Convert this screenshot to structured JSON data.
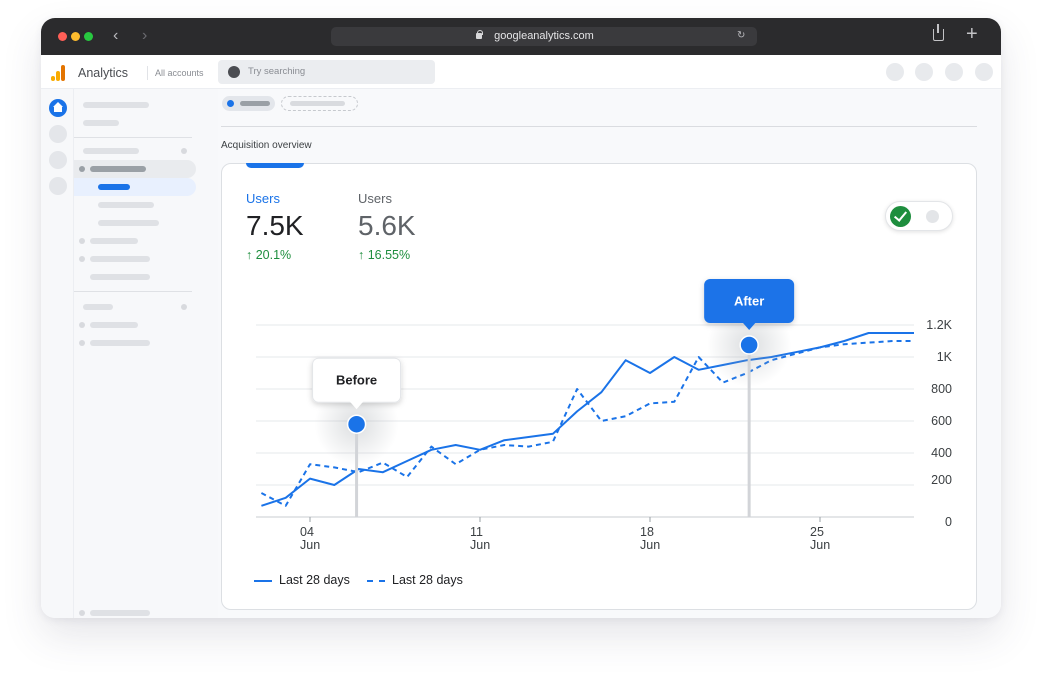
{
  "browser": {
    "url": "googleanalytics.com",
    "traffic_light_colors": [
      "#ff5f57",
      "#febc2e",
      "#28c840"
    ]
  },
  "app": {
    "title": "Analytics",
    "accounts_label": "All accounts",
    "search_placeholder": "Try searching",
    "brand_colors": [
      "#f9ab00",
      "#e37400"
    ]
  },
  "main": {
    "section_title": "Acquisition overview"
  },
  "metrics": [
    {
      "label": "Users",
      "value": "7.5K",
      "change": "↑ 20.1%",
      "color": "#1a73e8"
    },
    {
      "label": "Users",
      "value": "5.6K",
      "change": "↑ 16.55%",
      "color": "#5f6368"
    }
  ],
  "toggle": {
    "state": "on"
  },
  "callouts": {
    "before": "Before",
    "after": "After"
  },
  "legend": [
    {
      "label": "Last 28 days",
      "style": "solid"
    },
    {
      "label": "Last 28 days",
      "style": "dashed"
    }
  ],
  "chart_data": {
    "type": "line",
    "y_ticks": [
      "1.2K",
      "1K",
      "800",
      "600",
      "400",
      "200",
      "0"
    ],
    "x_ticks": [
      {
        "day": "04",
        "month": "Jun"
      },
      {
        "day": "11",
        "month": "Jun"
      },
      {
        "day": "18",
        "month": "Jun"
      },
      {
        "day": "25",
        "month": "Jun"
      }
    ],
    "ylim": [
      0,
      1200
    ],
    "grid": true,
    "legend_position": "bottom-left",
    "series": [
      {
        "color": "#1a73e8",
        "style": "solid",
        "x": [
          "Jun 2",
          "Jun 3",
          "Jun 4",
          "Jun 5",
          "Jun 6",
          "Jun 7",
          "Jun 8",
          "Jun 9",
          "Jun 10",
          "Jun 11",
          "Jun 12",
          "Jun 13",
          "Jun 14",
          "Jun 15",
          "Jun 16",
          "Jun 17",
          "Jun 18",
          "Jun 19",
          "Jun 20",
          "Jun 21",
          "Jun 22",
          "Jun 23",
          "Jun 24",
          "Jun 25",
          "Jun 26",
          "Jun 27",
          "Jun 28",
          "Jun 29"
        ],
        "values": [
          70,
          120,
          240,
          200,
          300,
          280,
          350,
          420,
          450,
          420,
          480,
          500,
          520,
          660,
          780,
          980,
          900,
          1000,
          920,
          950,
          980,
          1000,
          1030,
          1060,
          1100,
          1150,
          1150,
          1150
        ]
      },
      {
        "color": "#1a73e8",
        "style": "dashed",
        "x": [
          "Jun 2",
          "Jun 3",
          "Jun 4",
          "Jun 5",
          "Jun 6",
          "Jun 7",
          "Jun 8",
          "Jun 9",
          "Jun 10",
          "Jun 11",
          "Jun 12",
          "Jun 13",
          "Jun 14",
          "Jun 15",
          "Jun 16",
          "Jun 17",
          "Jun 18",
          "Jun 19",
          "Jun 20",
          "Jun 21",
          "Jun 22",
          "Jun 23",
          "Jun 24",
          "Jun 25",
          "Jun 26",
          "Jun 27",
          "Jun 28",
          "Jun 29"
        ],
        "values": [
          150,
          70,
          330,
          310,
          280,
          340,
          250,
          440,
          330,
          420,
          450,
          440,
          470,
          800,
          600,
          630,
          710,
          720,
          1000,
          840,
          900,
          980,
          1020,
          1060,
          1080,
          1090,
          1100,
          1100
        ]
      }
    ],
    "annotations": [
      {
        "label": "Before",
        "x": "Jun 6",
        "value": 580
      },
      {
        "label": "After",
        "x": "Jun 22",
        "value": 1075
      }
    ]
  }
}
